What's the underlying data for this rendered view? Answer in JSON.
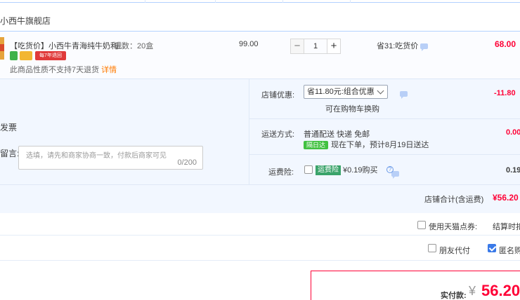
{
  "shop": {
    "name": "小西牛旗舰店"
  },
  "item": {
    "title": "【吃货价】小西牛青海纯牛奶利...",
    "sku": "罐数：20盒",
    "badge_text": "每7年退回",
    "note": "此商品性质不支持7天退货",
    "note_link": "详情",
    "price": "99.00",
    "quantity": "1",
    "minus": "−",
    "plus": "+",
    "saving": "省31:吃货价",
    "subtotal": "68.00"
  },
  "invoice": {
    "label": "发票"
  },
  "message": {
    "label": "留言:",
    "placeholder": "选填，请先和商家协商一致，付款后商家可见",
    "counter": "0/200"
  },
  "store_discount": {
    "label": "店铺优惠:",
    "selected": "省11.80元:组合优惠",
    "hint": "可在购物车换购",
    "amount": "-11.80"
  },
  "shipping": {
    "label": "运送方式:",
    "method": "普通配送 快递 免邮",
    "tag": "隔日达",
    "eta": "现在下单，预计8月19日送达",
    "amount": "0.00"
  },
  "insurance": {
    "label": "运费险:",
    "tag": "运费险",
    "price": "¥0.19购买",
    "amount": "0.19"
  },
  "shop_total": {
    "label": "店铺合计(含运费)",
    "value": "¥56.20"
  },
  "options": {
    "tmall_points": "使用天猫点券:",
    "settle_hint": "结算时扣",
    "friend_pay": "朋友代付",
    "anonymous": "匿名购"
  },
  "payment": {
    "label": "实付款:",
    "currency": "¥",
    "value": "56.20"
  },
  "colors": {
    "accent_red": "#ff0036",
    "border_blue": "#b2d1ff",
    "panel_bg": "#f2f7ff",
    "check_blue": "#3a7ae8"
  }
}
